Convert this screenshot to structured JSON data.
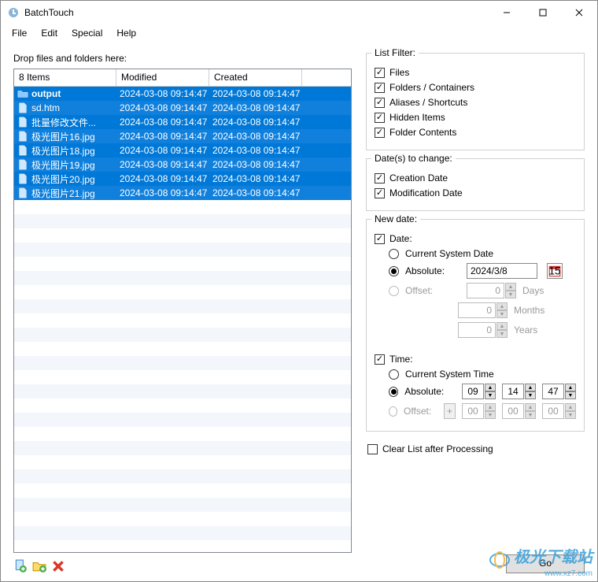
{
  "window": {
    "title": "BatchTouch"
  },
  "menu": {
    "file": "File",
    "edit": "Edit",
    "special": "Special",
    "help": "Help"
  },
  "left": {
    "drop_label": "Drop files and folders here:",
    "columns": {
      "items": "8 Items",
      "modified": "Modified",
      "created": "Created"
    },
    "rows": [
      {
        "type": "folder",
        "name": "output",
        "modified": "2024-03-08 09:14:47",
        "created": "2024-03-08 09:14:47",
        "bold": true
      },
      {
        "type": "file",
        "name": "sd.htm",
        "modified": "2024-03-08 09:14:47",
        "created": "2024-03-08 09:14:47"
      },
      {
        "type": "file",
        "name": "批量修改文件...",
        "modified": "2024-03-08 09:14:47",
        "created": "2024-03-08 09:14:47"
      },
      {
        "type": "file",
        "name": "极光图片16.jpg",
        "modified": "2024-03-08 09:14:47",
        "created": "2024-03-08 09:14:47"
      },
      {
        "type": "file",
        "name": "极光图片18.jpg",
        "modified": "2024-03-08 09:14:47",
        "created": "2024-03-08 09:14:47"
      },
      {
        "type": "file",
        "name": "极光图片19.jpg",
        "modified": "2024-03-08 09:14:47",
        "created": "2024-03-08 09:14:47"
      },
      {
        "type": "file",
        "name": "极光图片20.jpg",
        "modified": "2024-03-08 09:14:47",
        "created": "2024-03-08 09:14:47"
      },
      {
        "type": "file",
        "name": "极光图片21.jpg",
        "modified": "2024-03-08 09:14:47",
        "created": "2024-03-08 09:14:47"
      }
    ]
  },
  "filter": {
    "legend": "List Filter:",
    "files": "Files",
    "folders": "Folders / Containers",
    "aliases": "Aliases / Shortcuts",
    "hidden": "Hidden Items",
    "contents": "Folder Contents"
  },
  "dates": {
    "legend": "Date(s) to change:",
    "creation": "Creation Date",
    "modification": "Modification Date"
  },
  "newdate": {
    "legend": "New date:",
    "date_label": "Date:",
    "current_date": "Current System Date",
    "absolute": "Absolute:",
    "absolute_value": "2024/3/8",
    "offset": "Offset:",
    "days": "Days",
    "months": "Months",
    "years": "Years",
    "offset_days": "0",
    "offset_months": "0",
    "offset_years": "0",
    "time_label": "Time:",
    "current_time": "Current System Time",
    "time_absolute": "Absolute:",
    "time_h": "09",
    "time_m": "14",
    "time_s": "47",
    "time_offset": "Offset:",
    "toff_h": "00",
    "toff_m": "00",
    "toff_s": "00"
  },
  "clear_label": "Clear List after Processing",
  "go_label": "Go",
  "watermark": {
    "cn": "极光下载站",
    "url": "www.xz7.com"
  }
}
